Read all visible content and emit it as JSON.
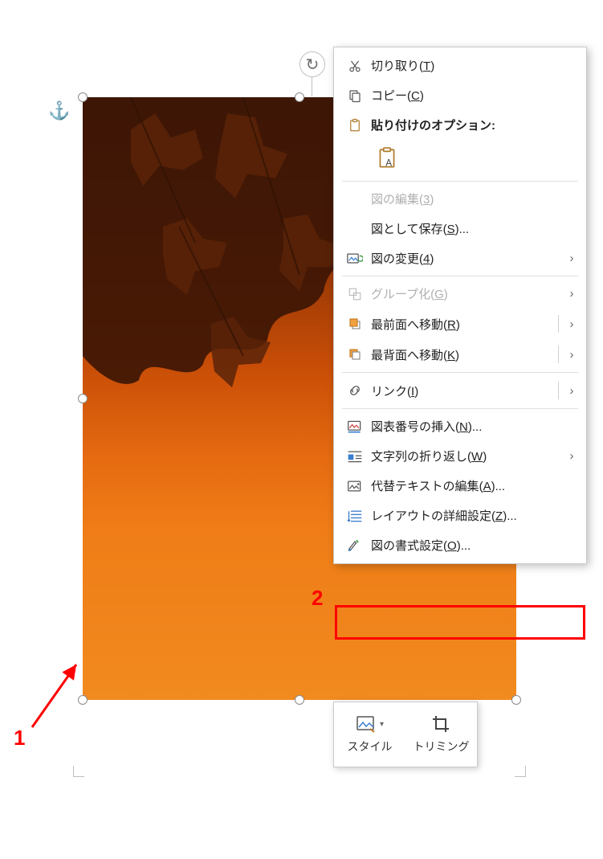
{
  "menu": {
    "cut": {
      "label": "切り取り",
      "key": "T"
    },
    "copy": {
      "label": "コピー",
      "key": "C"
    },
    "pasteHdr": {
      "label": "貼り付けのオプション:"
    },
    "editFig": {
      "label": "図の編集",
      "key": "3"
    },
    "saveAs": {
      "label": "図として保存",
      "key": "S",
      "suffix": "..."
    },
    "change": {
      "label": "図の変更",
      "key": "4"
    },
    "group": {
      "label": "グループ化",
      "key": "G"
    },
    "front": {
      "label": "最前面へ移動",
      "key": "R"
    },
    "back": {
      "label": "最背面へ移動",
      "key": "K"
    },
    "link": {
      "label": "リンク",
      "key": "I"
    },
    "caption": {
      "label": "図表番号の挿入",
      "key": "N",
      "suffix": "..."
    },
    "wrap": {
      "label": "文字列の折り返し",
      "key": "W"
    },
    "altText": {
      "label": "代替テキストの編集",
      "key": "A",
      "suffix": "..."
    },
    "layout": {
      "label": "レイアウトの詳細設定",
      "key": "Z",
      "suffix": "..."
    },
    "format": {
      "label": "図の書式設定",
      "key": "O",
      "suffix": "..."
    }
  },
  "miniToolbar": {
    "style": "スタイル",
    "crop": "トリミング"
  },
  "annotations": {
    "one": "1",
    "two": "2"
  }
}
